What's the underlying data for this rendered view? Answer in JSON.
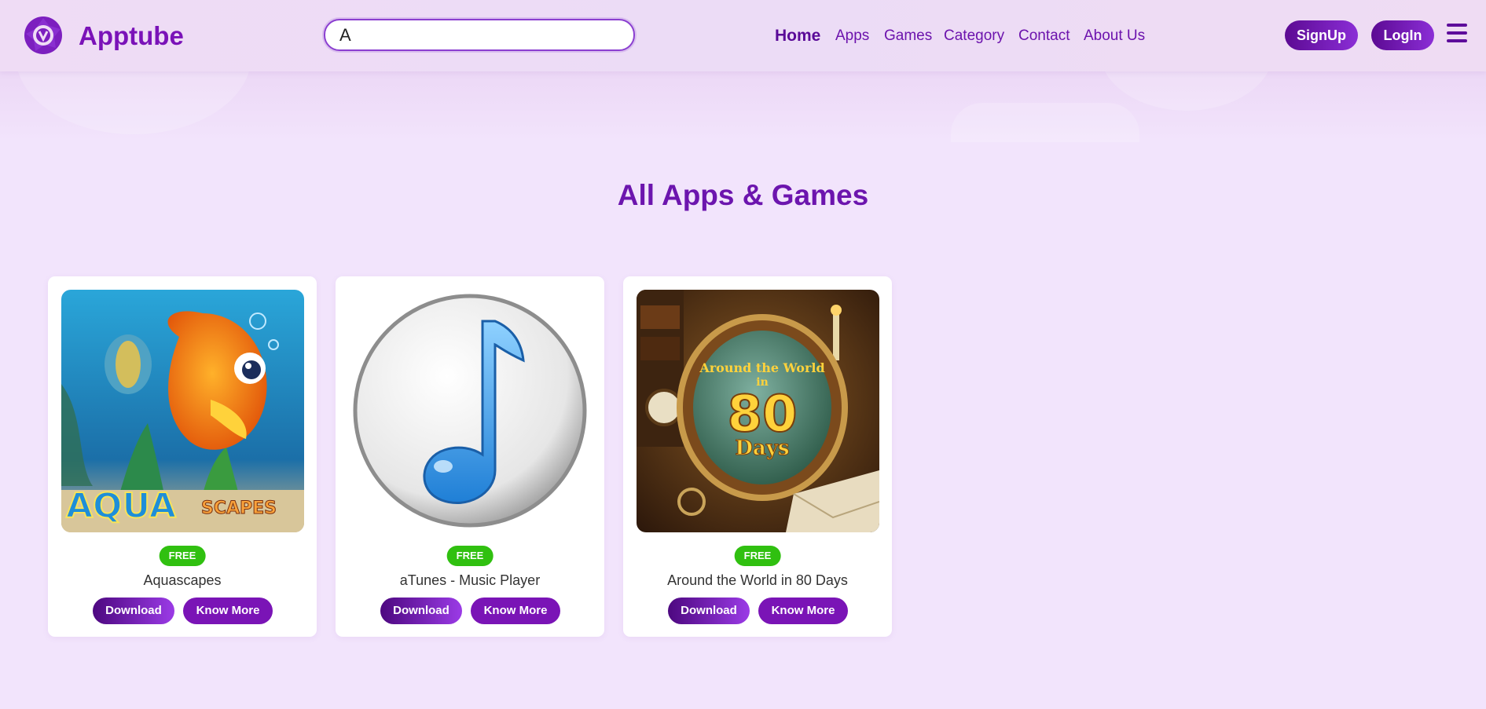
{
  "brand": {
    "name": "Apptube"
  },
  "search": {
    "value": "A",
    "placeholder": ""
  },
  "nav": {
    "items": [
      "Home",
      "Apps",
      "Games",
      "Category",
      "Contact",
      "About Us"
    ],
    "active": "Home"
  },
  "auth": {
    "signup_label": "SignUp",
    "login_label": "LogIn"
  },
  "menu_icon": "hamburger-icon",
  "main": {
    "title": "All Apps & Games",
    "cards": [
      {
        "name": "Aquascapes",
        "badge": "FREE",
        "download_label": "Download",
        "more_label": "Know More",
        "image_icon": "aquascapes-fish-image"
      },
      {
        "name": "aTunes - Music Player",
        "badge": "FREE",
        "download_label": "Download",
        "more_label": "Know More",
        "image_icon": "music-note-image"
      },
      {
        "name": "Around the World in 80 Days",
        "badge": "FREE",
        "download_label": "Download",
        "more_label": "Know More",
        "image_icon": "80-days-globe-image"
      }
    ]
  },
  "colors": {
    "accent": "#7a12b8",
    "badge_green": "#30c010",
    "page_bg": "#f2e4fc"
  }
}
